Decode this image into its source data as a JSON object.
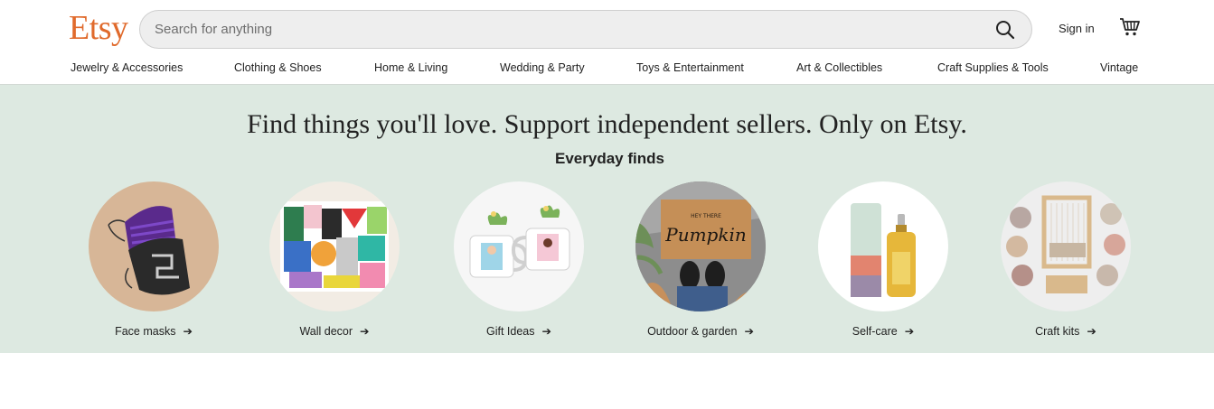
{
  "header": {
    "logo": "Etsy",
    "search_placeholder": "Search for anything",
    "sign_in": "Sign in",
    "brand_color": "#e06a2c"
  },
  "nav": {
    "items": [
      "Jewelry & Accessories",
      "Clothing & Shoes",
      "Home & Living",
      "Wedding & Party",
      "Toys & Entertainment",
      "Art & Collectibles",
      "Craft Supplies & Tools",
      "Vintage"
    ]
  },
  "hero": {
    "headline": "Find things you'll love. Support independent sellers. Only on Etsy.",
    "subheading": "Everyday finds",
    "background": "#dde9e1",
    "arrow": "➔",
    "cards": [
      {
        "label": "Face masks"
      },
      {
        "label": "Wall decor"
      },
      {
        "label": "Gift Ideas"
      },
      {
        "label": "Outdoor & garden"
      },
      {
        "label": "Self-care"
      },
      {
        "label": "Craft kits"
      }
    ]
  },
  "doormat_text": "HEY THERE Pumpkin",
  "icons": {
    "search": "search-icon",
    "cart": "cart-icon",
    "arrow": "arrow-right-icon"
  }
}
